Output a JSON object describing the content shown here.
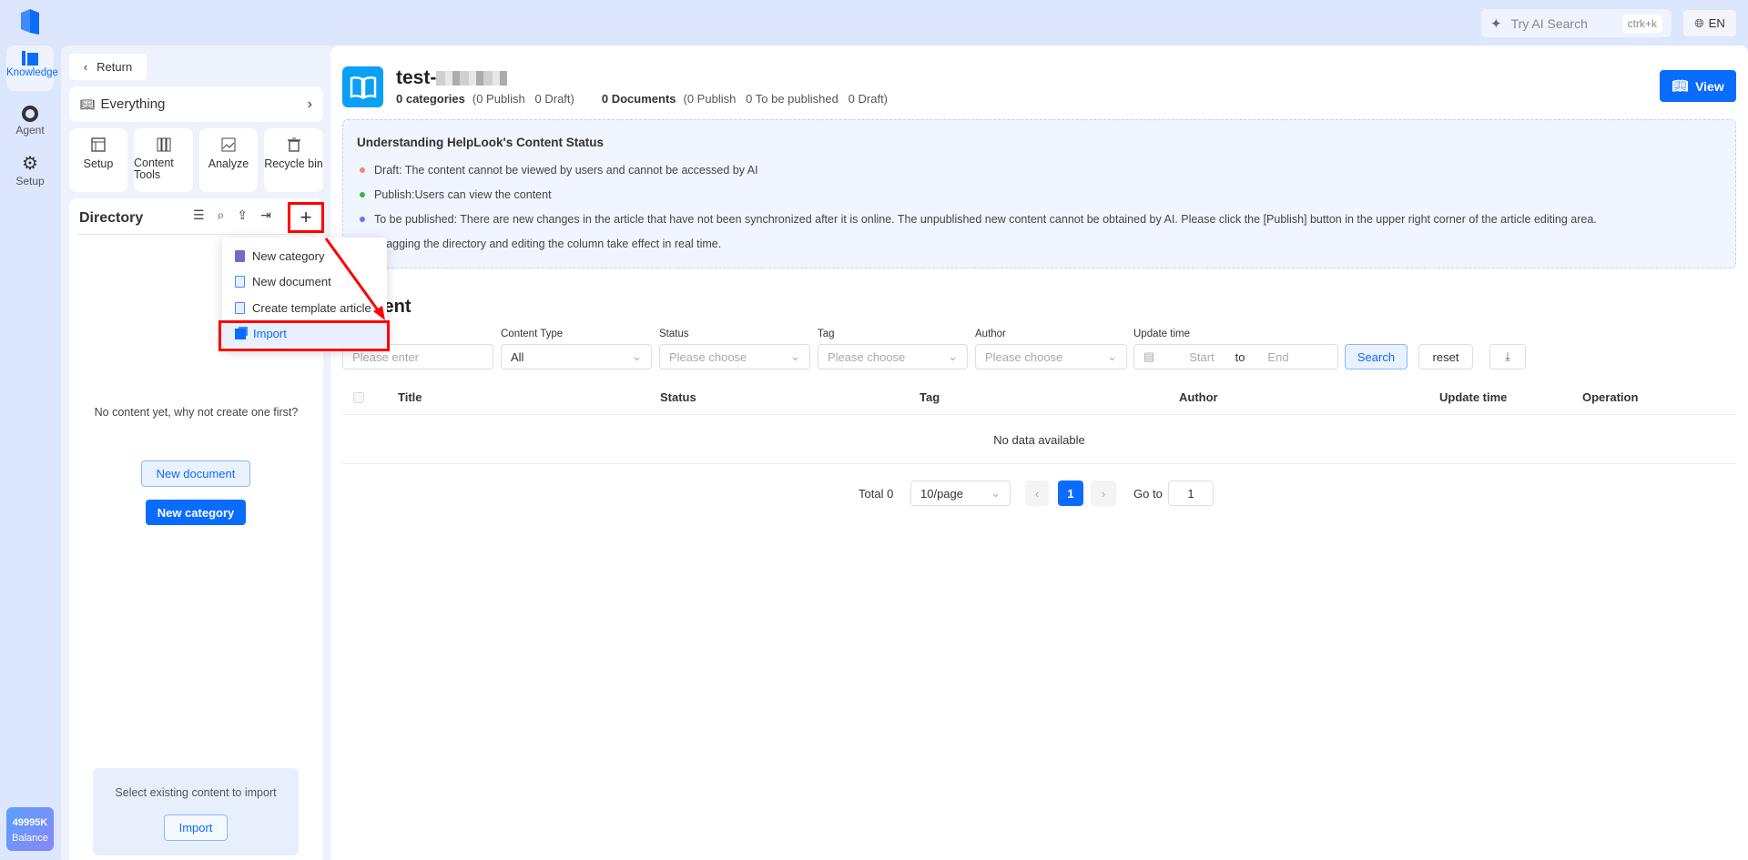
{
  "topbar": {
    "ai_search": "Try AI Search",
    "shortcut": "ctrk+k",
    "language": "EN"
  },
  "rail": {
    "items": [
      {
        "label": "Knowledge"
      },
      {
        "label": "Agent"
      },
      {
        "label": "Setup"
      }
    ],
    "balance_value": "49995K",
    "balance_label": "Balance"
  },
  "sidebar": {
    "return_label": "Return",
    "scope_label": "Everything",
    "tools": [
      {
        "label": "Setup"
      },
      {
        "label": "Content Tools"
      },
      {
        "label": "Analyze"
      },
      {
        "label": "Recycle bin"
      }
    ],
    "directory_title": "Directory",
    "empty_text": "No content yet, why not create one first?",
    "new_document": "New document",
    "new_category": "New category",
    "import_hint": "Select existing content to import",
    "import_button": "Import",
    "menu": [
      {
        "label": "New category"
      },
      {
        "label": "New document"
      },
      {
        "label": "Create template article"
      },
      {
        "label": "Import"
      }
    ]
  },
  "header": {
    "title": "test-",
    "categories": "0 categories",
    "categories_detail": "(0 Publish   0 Draft)",
    "documents": "0 Documents",
    "documents_detail": "(0 Publish   0 To be published   0 Draft)",
    "view_button": "View"
  },
  "info": {
    "title": "Understanding HelpLook's Content Status",
    "items": [
      {
        "text": "Draft: The content cannot be viewed by users and cannot be accessed by AI",
        "color": "#f08a6c"
      },
      {
        "text": "Publish:Users can view the content",
        "color": "#3bb34a"
      },
      {
        "text": "To be published: There are new changes in the article that have not been synchronized after it is online. The unpublished new content cannot be obtained by AI. Please click the [Publish] button in the upper right corner of the article editing area.",
        "color": "#5b7cf0"
      }
    ],
    "note": "Dragging the directory and editing the column take effect in real time."
  },
  "content": {
    "heading": "Content",
    "filters": {
      "title_placeholder": "Please enter",
      "content_type_label": "Content Type",
      "content_type_value": "All",
      "status_label": "Status",
      "status_placeholder": "Please choose",
      "tag_label": "Tag",
      "tag_placeholder": "Please choose",
      "author_label": "Author",
      "author_placeholder": "Please choose",
      "update_label": "Update time",
      "start": "Start",
      "to": "to",
      "end": "End",
      "search": "Search",
      "reset": "reset"
    },
    "columns": [
      "Title",
      "Status",
      "Tag",
      "Author",
      "Update time",
      "Operation"
    ],
    "empty": "No data available",
    "pagination": {
      "total": "Total 0",
      "page_size": "10/page",
      "current": "1",
      "goto_label": "Go to",
      "goto_value": "1"
    }
  },
  "colors": {
    "accent": "#0a6cff",
    "annotation": "#ff0000"
  }
}
